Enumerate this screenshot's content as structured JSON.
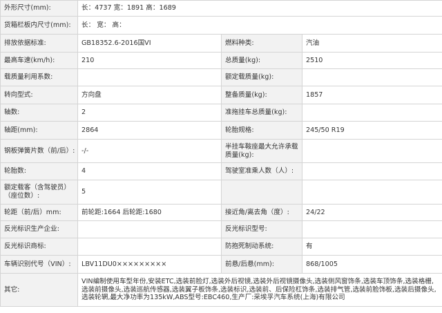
{
  "rows": [
    {
      "l1": "外形尺寸(mm):",
      "v1": "长：4737 宽：1891 高：1689"
    },
    {
      "l1": "货箱栏板内尺寸(mm):",
      "v1": "长：  宽：  高："
    },
    {
      "l1": "排放依据标准:",
      "v1": "GB18352.6-2016国VI",
      "l2": "燃料种类:",
      "v2": "汽油"
    },
    {
      "l1": "最高车速(km/h):",
      "v1": "210",
      "l2": "总质量(kg):",
      "v2": "2510"
    },
    {
      "l1": "载质量利用系数:",
      "v1": "",
      "l2": "额定载质量(kg):",
      "v2": ""
    },
    {
      "l1": "转向型式:",
      "v1": "方向盘",
      "l2": "整备质量(kg):",
      "v2": "1857"
    },
    {
      "l1": "轴数:",
      "v1": "2",
      "l2": "准拖挂车总质量(kg):",
      "v2": ""
    },
    {
      "l1": "轴距(mm):",
      "v1": "2864",
      "l2": "轮胎规格:",
      "v2": "245/50 R19"
    },
    {
      "l1": "钢板弹簧片数（前/后）:",
      "v1": "-/-",
      "l2": "半挂车鞍座最大允许承载质量(kg):",
      "v2": ""
    },
    {
      "l1": "轮胎数:",
      "v1": "4",
      "l2": "驾驶室准乘人数（人）:",
      "v2": ""
    },
    {
      "l1": "额定载客（含驾驶员）（座位数）:",
      "v1": "5",
      "l2": "",
      "v2": ""
    },
    {
      "l1": "轮距（前/后）mm:",
      "v1": "前轮距:1664 后轮距:1680",
      "l2": "接近角/离去角（度）:",
      "v2": "24/22"
    },
    {
      "l1": "反光标识生产企业:",
      "v1": "",
      "l2": "反光标识型号:",
      "v2": ""
    },
    {
      "l1": "反光标识商标:",
      "v1": "",
      "l2": "防抱死制动系统:",
      "v2": "有"
    },
    {
      "l1": "车辆识别代号（VIN）:",
      "v1": "LBV11DU0×××××××××",
      "l2": "前悬/后悬(mm):",
      "v2": "868/1005"
    }
  ],
  "other": {
    "label": "其它:",
    "value": "VIN编制使用车型年份,安装ETC,选装前脸灯,选装外后视镜,选装外后视镜摄像头,选装侧风窗饰条,选装车顶饰条,选装格栅,选装前摄像头,选装巡航传感器,选装翼子板饰条,选装标识,选装前、后保险杠饰条,选装排气管,选装前脸饰板,选装后摄像头,选装轮辋,最大净功率为135kW,ABS型号:EBC460,生产厂:采埃孚汽车系统(上海)有限公司"
  }
}
